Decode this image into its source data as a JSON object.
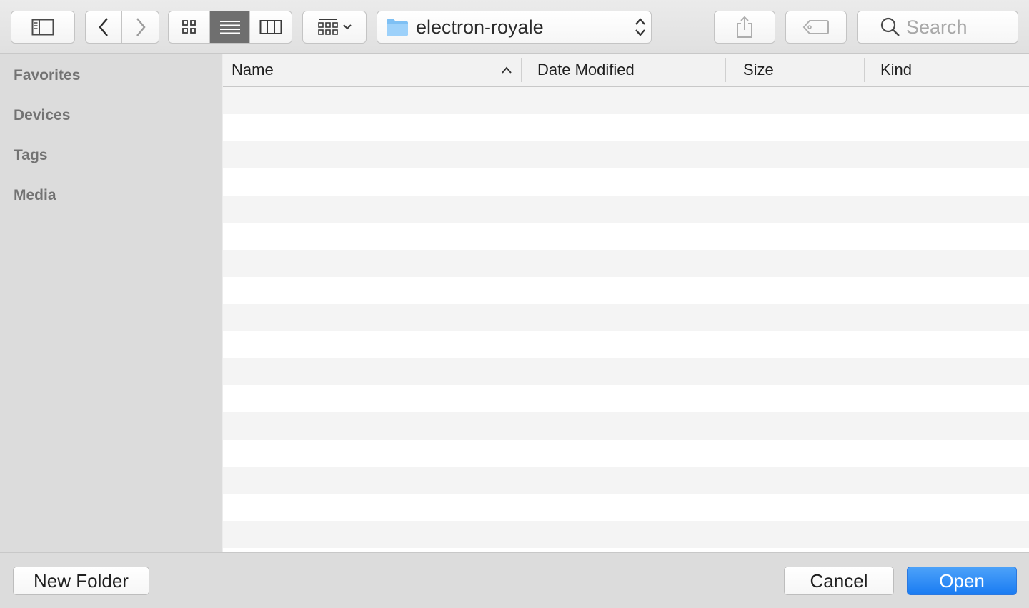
{
  "toolbar": {
    "location": "electron-royale",
    "search_placeholder": "Search",
    "icons": {
      "sidebar_toggle": "sidebar-toggle-icon",
      "back": "chevron-left-icon",
      "forward": "chevron-right-icon",
      "icon_view": "icon-grid-icon",
      "list_view": "list-view-icon",
      "column_view": "column-view-icon",
      "arrange": "arrange-grid-icon",
      "folder": "folder-icon",
      "share": "share-icon",
      "tag": "tag-icon",
      "search": "search-icon"
    },
    "active_view": "list"
  },
  "sidebar": {
    "sections": [
      "Favorites",
      "Devices",
      "Tags",
      "Media"
    ]
  },
  "file_list": {
    "columns": [
      "Name",
      "Date Modified",
      "Size",
      "Kind"
    ],
    "sort_column": "Name",
    "sort_direction": "ascending",
    "rows": []
  },
  "footer": {
    "new_folder_label": "New Folder",
    "cancel_label": "Cancel",
    "open_label": "Open"
  },
  "colors": {
    "accent": "#1a7cf2",
    "active_segment": "#6f6f6f",
    "sidebar_bg": "#dcdcdc",
    "stripe": "#f4f4f4"
  }
}
